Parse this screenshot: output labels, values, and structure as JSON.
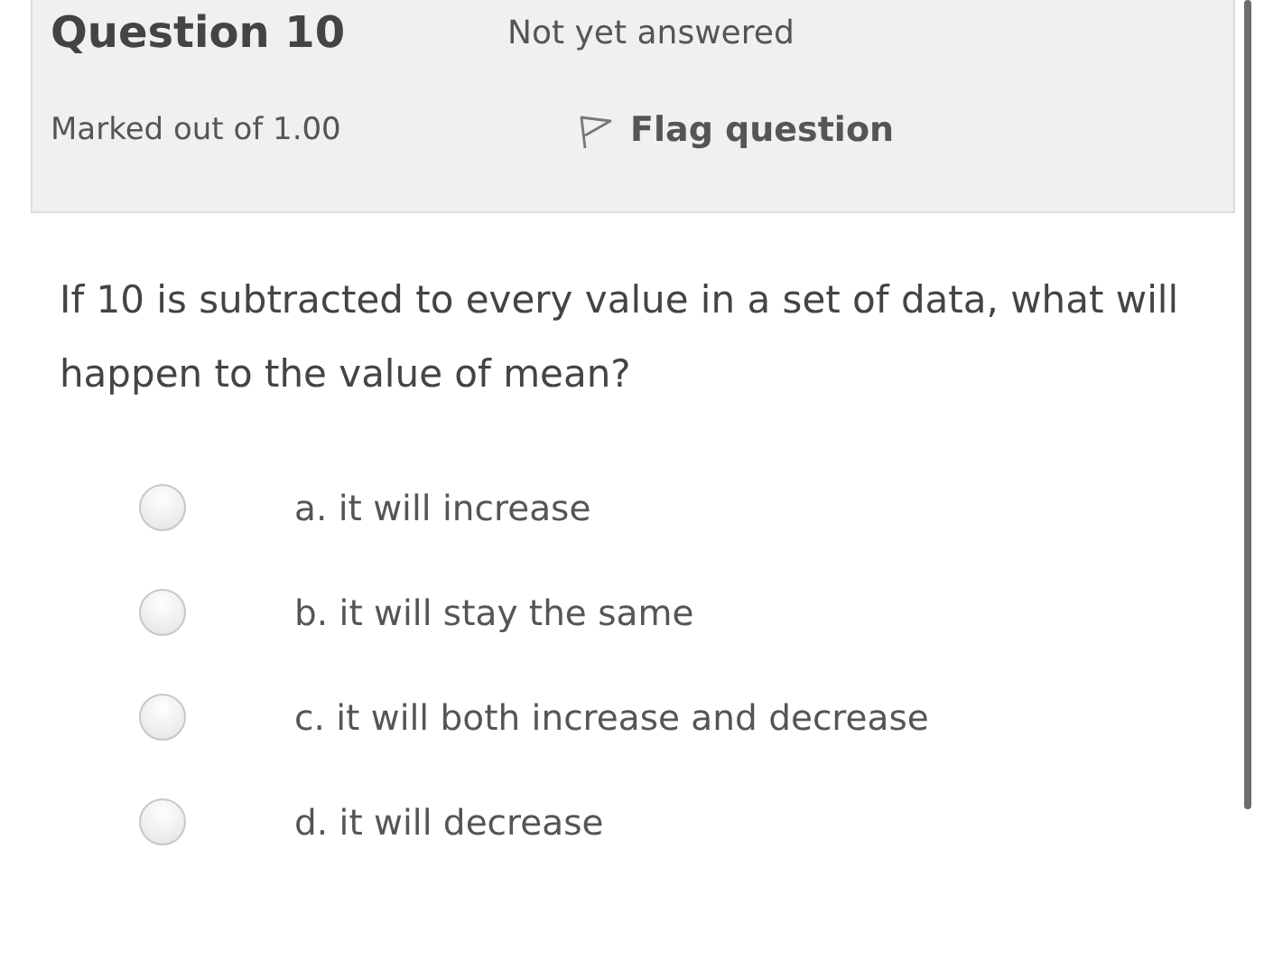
{
  "info": {
    "title": "Question 10",
    "status": "Not yet answered",
    "marks": "Marked out of 1.00",
    "flag": {
      "label": "Flag question",
      "flagged": false
    }
  },
  "question": {
    "text": "If 10 is subtracted to every value in a set of data, what will happen to the value of mean?",
    "options": [
      {
        "label": "a. it will increase",
        "selected": false
      },
      {
        "label": "b. it will stay the same",
        "selected": false
      },
      {
        "label": "c. it will both increase and decrease",
        "selected": false
      },
      {
        "label": "d. it will decrease",
        "selected": false
      }
    ]
  }
}
